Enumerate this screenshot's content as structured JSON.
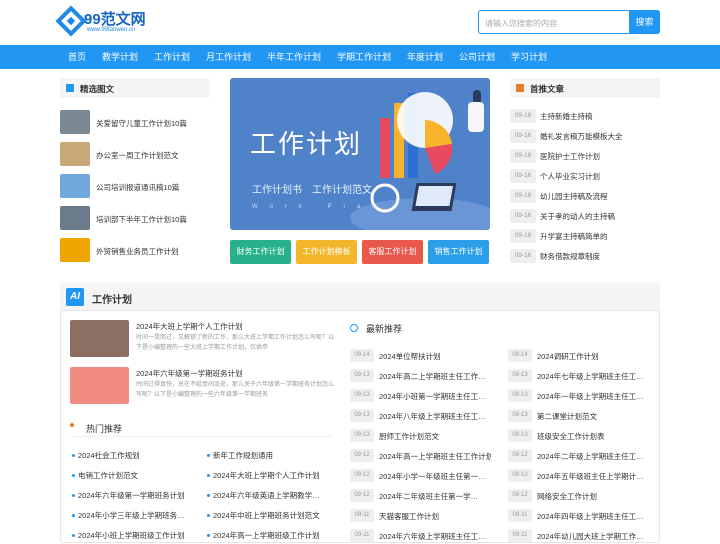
{
  "header": {
    "logo_text": "99范文网",
    "logo_url_text": "www.99fanwen.cn",
    "search_placeholder": "请输入您搜索的内容",
    "search_button": "搜索"
  },
  "nav": [
    "首页",
    "教学计划",
    "工作计划",
    "月工作计划",
    "半年工作计划",
    "学期工作计划",
    "年度计划",
    "公司计划",
    "学习计划"
  ],
  "featured": {
    "title": "精选图文",
    "items": [
      {
        "text": "关爱留守儿童工作计划10篇",
        "thumb_color": "#7a8894"
      },
      {
        "text": "办公室一周工作计划范文",
        "thumb_color": "#c8a878"
      },
      {
        "text": "公司培训报道通讯稿10篇",
        "thumb_color": "#6fa8dc"
      },
      {
        "text": "培训部下半年工作计划10篇",
        "thumb_color": "#6b7b8c"
      },
      {
        "text": "外贸销售业务员工作计划",
        "thumb_color": "#f0a500"
      }
    ]
  },
  "banner": {
    "title": "工作计划",
    "subtitle": "工作计划书　工作计划范文",
    "watermark": "Work Plan"
  },
  "tags": [
    {
      "label": "财务工作计划",
      "color": "#26b18a"
    },
    {
      "label": "工作计划模板",
      "color": "#f3b52a"
    },
    {
      "label": "客服工作计划",
      "color": "#e8584d"
    },
    {
      "label": "销售工作计划",
      "color": "#2a9ee8"
    }
  ],
  "recommended": {
    "title": "首推文章",
    "items": [
      {
        "date": "09-16",
        "text": "主持新婚主持稿"
      },
      {
        "date": "09-16",
        "text": "婚礼发言稿万能模板大全"
      },
      {
        "date": "09-16",
        "text": "医院护士工作计划"
      },
      {
        "date": "09-16",
        "text": "个人毕业实习计划"
      },
      {
        "date": "09-16",
        "text": "幼儿园主持稿及流程"
      },
      {
        "date": "09-16",
        "text": "关于孝的动人的主持稿"
      },
      {
        "date": "09-16",
        "text": "升学宴主持稿简单的"
      },
      {
        "date": "09-16",
        "text": "财务借款规章制度"
      }
    ]
  },
  "section": {
    "logo": "AI",
    "title": "工作计划",
    "articles": [
      {
        "title": "2024年大班上学期个人工作计划",
        "desc": "时间一晃而过，又解锁了新的工作，那么大班上学期工作计划怎么写呢？以下是小编整理的一些大班上学期工作计划，仅供参",
        "thumb_color": "#8d6e63"
      },
      {
        "title": "2024年六年级第一学期班务计划",
        "desc": "时间过得真快，总在不经意间流逝，那么关于六年级第一学期班务计划怎么写呢？以下是小编整理的一些六年级第一学期班务",
        "thumb_color": "#f28b82"
      }
    ],
    "hot_title": "热门推荐",
    "hot": [
      "2024社会工作规划",
      "新年工作规划通用",
      "电销工作计划范文",
      "2024年大班上学期个人工作计划",
      "2024年六年级第一学期班务计划",
      "2024年六年级英语上学期教学…",
      "2024年小学三年级上学期班务…",
      "2024年中班上学期班务计划范文",
      "2024年小班上学期班级工作计划",
      "2024年高一上学期班级工作计划"
    ],
    "latest_title": "最新推荐",
    "latest": [
      {
        "date": "09-14",
        "text": "2024单位帮扶计划"
      },
      {
        "date": "09-14",
        "text": "2024调研工作计划"
      },
      {
        "date": "09-13",
        "text": "2024年高二上学期班主任工作…"
      },
      {
        "date": "09-13",
        "text": "2024年七年级上学期班主任工…"
      },
      {
        "date": "09-13",
        "text": "2024年小班第一学期班主任工…"
      },
      {
        "date": "09-13",
        "text": "2024年一年级上学期班主任工…"
      },
      {
        "date": "09-13",
        "text": "2024年八年级上学期班主任工…"
      },
      {
        "date": "09-13",
        "text": "第二课堂计划范文"
      },
      {
        "date": "09-13",
        "text": "厨师工作计划范文"
      },
      {
        "date": "09-13",
        "text": "班级安全工作计划表"
      },
      {
        "date": "09-12",
        "text": "2024年高一上学期班主任工作计划"
      },
      {
        "date": "09-12",
        "text": "2024年二年级上学期班主任工…"
      },
      {
        "date": "09-12",
        "text": "2024年小学一年级班主任第一…"
      },
      {
        "date": "09-12",
        "text": "2024年五年级班主任上学期计…"
      },
      {
        "date": "09-12",
        "text": "2024年二年级班主任第一学…"
      },
      {
        "date": "09-12",
        "text": "网络安全工作计划"
      },
      {
        "date": "09-11",
        "text": "天猫客服工作计划"
      },
      {
        "date": "09-11",
        "text": "2024年四年级上学期班主任工…"
      },
      {
        "date": "09-11",
        "text": "2024年六年级上学期班主任工…"
      },
      {
        "date": "09-11",
        "text": "2024年幼儿园大班上学期工作…"
      }
    ]
  }
}
